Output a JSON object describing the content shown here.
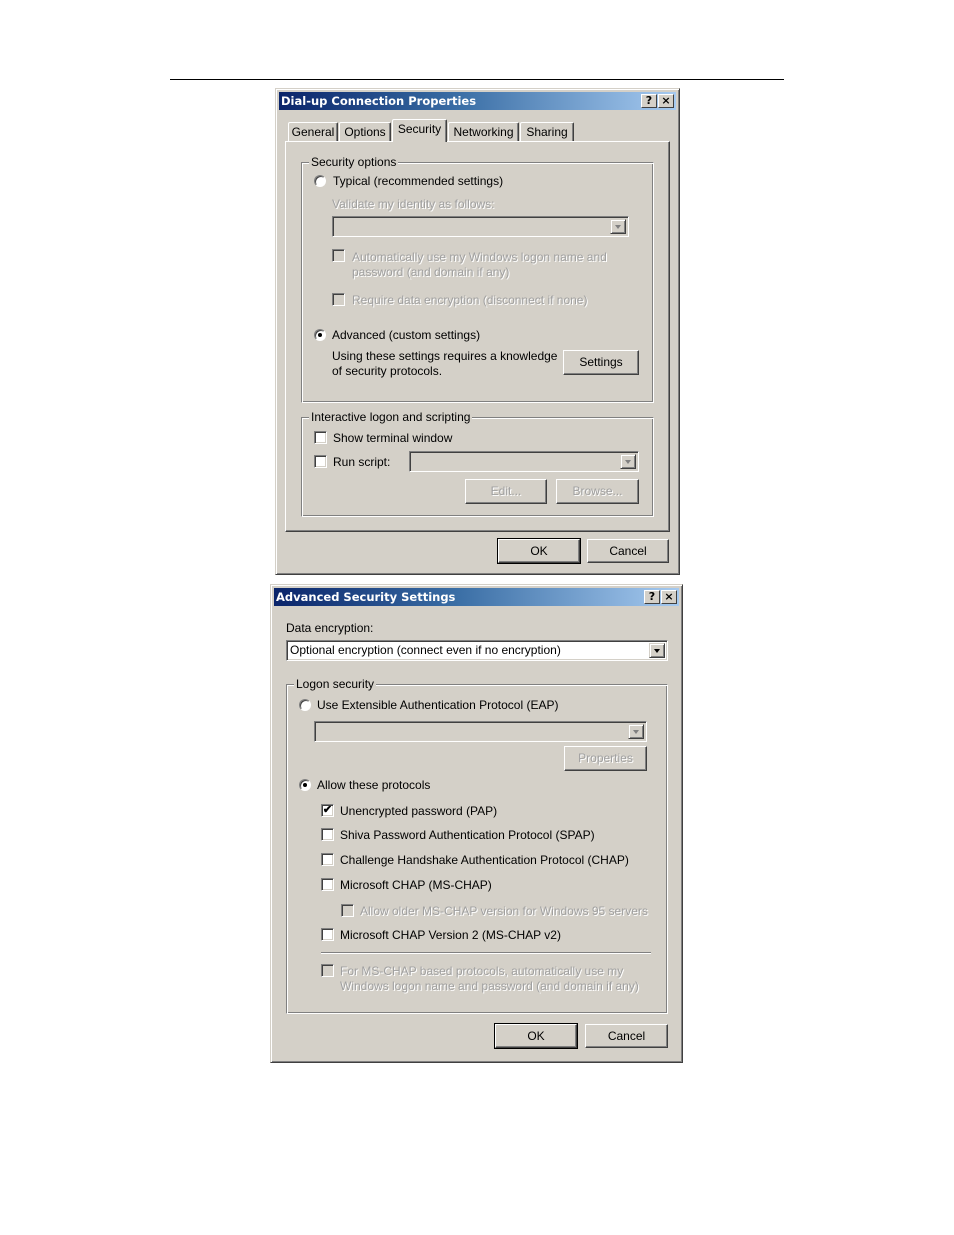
{
  "dial_up_dialog": {
    "title": "Dial-up Connection Properties",
    "help_button": "?",
    "close_button": "×",
    "tabs": [
      {
        "label": "General",
        "active": false
      },
      {
        "label": "Options",
        "active": false
      },
      {
        "label": "Security",
        "active": true
      },
      {
        "label": "Networking",
        "active": false
      },
      {
        "label": "Sharing",
        "active": false
      }
    ],
    "security_options": {
      "group_title": "Security options",
      "typical_radio": {
        "label": "Typical (recommended settings)",
        "checked": false
      },
      "validate_label": "Validate my identity as follows:",
      "validate_combo_value": "",
      "auto_logon_check": {
        "label_line1": "Automatically use my Windows logon name and",
        "label_line2": "password (and domain if any)",
        "checked": false,
        "enabled": false
      },
      "require_encryption_check": {
        "label": "Require data encryption (disconnect if none)",
        "checked": false,
        "enabled": false
      },
      "advanced_radio": {
        "label": "Advanced (custom settings)",
        "checked": true
      },
      "advanced_note_line1": "Using these settings requires a knowledge",
      "advanced_note_line2": "of security protocols.",
      "settings_button": "Settings"
    },
    "interactive_logon": {
      "group_title": "Interactive logon and scripting",
      "show_terminal_check": {
        "label": "Show terminal window",
        "checked": false
      },
      "run_script_check": {
        "label": "Run script:",
        "checked": false
      },
      "script_combo_value": "",
      "edit_button": "Edit...",
      "browse_button": "Browse..."
    },
    "ok_button": "OK",
    "cancel_button": "Cancel"
  },
  "advanced_dialog": {
    "title": "Advanced Security Settings",
    "help_button": "?",
    "close_button": "×",
    "data_encryption_label": "Data encryption:",
    "data_encryption_value": "Optional encryption (connect even if no encryption)",
    "logon_security": {
      "group_title": "Logon security",
      "eap_radio": {
        "label": "Use Extensible Authentication Protocol (EAP)",
        "checked": false
      },
      "eap_combo_value": "",
      "properties_button": "Properties",
      "allow_radio": {
        "label": "Allow these protocols",
        "checked": true
      },
      "protocols": [
        {
          "label": "Unencrypted password (PAP)",
          "checked": true,
          "enabled": true
        },
        {
          "label": "Shiva Password Authentication Protocol (SPAP)",
          "checked": false,
          "enabled": true
        },
        {
          "label": "Challenge Handshake Authentication Protocol (CHAP)",
          "checked": false,
          "enabled": true
        },
        {
          "label": "Microsoft CHAP (MS-CHAP)",
          "checked": false,
          "enabled": true
        },
        {
          "label": "Allow older MS-CHAP version for Windows 95 servers",
          "checked": false,
          "enabled": false
        },
        {
          "label": "Microsoft CHAP Version 2 (MS-CHAP v2)",
          "checked": false,
          "enabled": true
        }
      ],
      "mschap_auto_check": {
        "label_line1": "For MS-CHAP based protocols, automatically use my",
        "label_line2": "Windows logon name and password (and domain if any)",
        "checked": false,
        "enabled": false
      }
    },
    "ok_button": "OK",
    "cancel_button": "Cancel"
  }
}
